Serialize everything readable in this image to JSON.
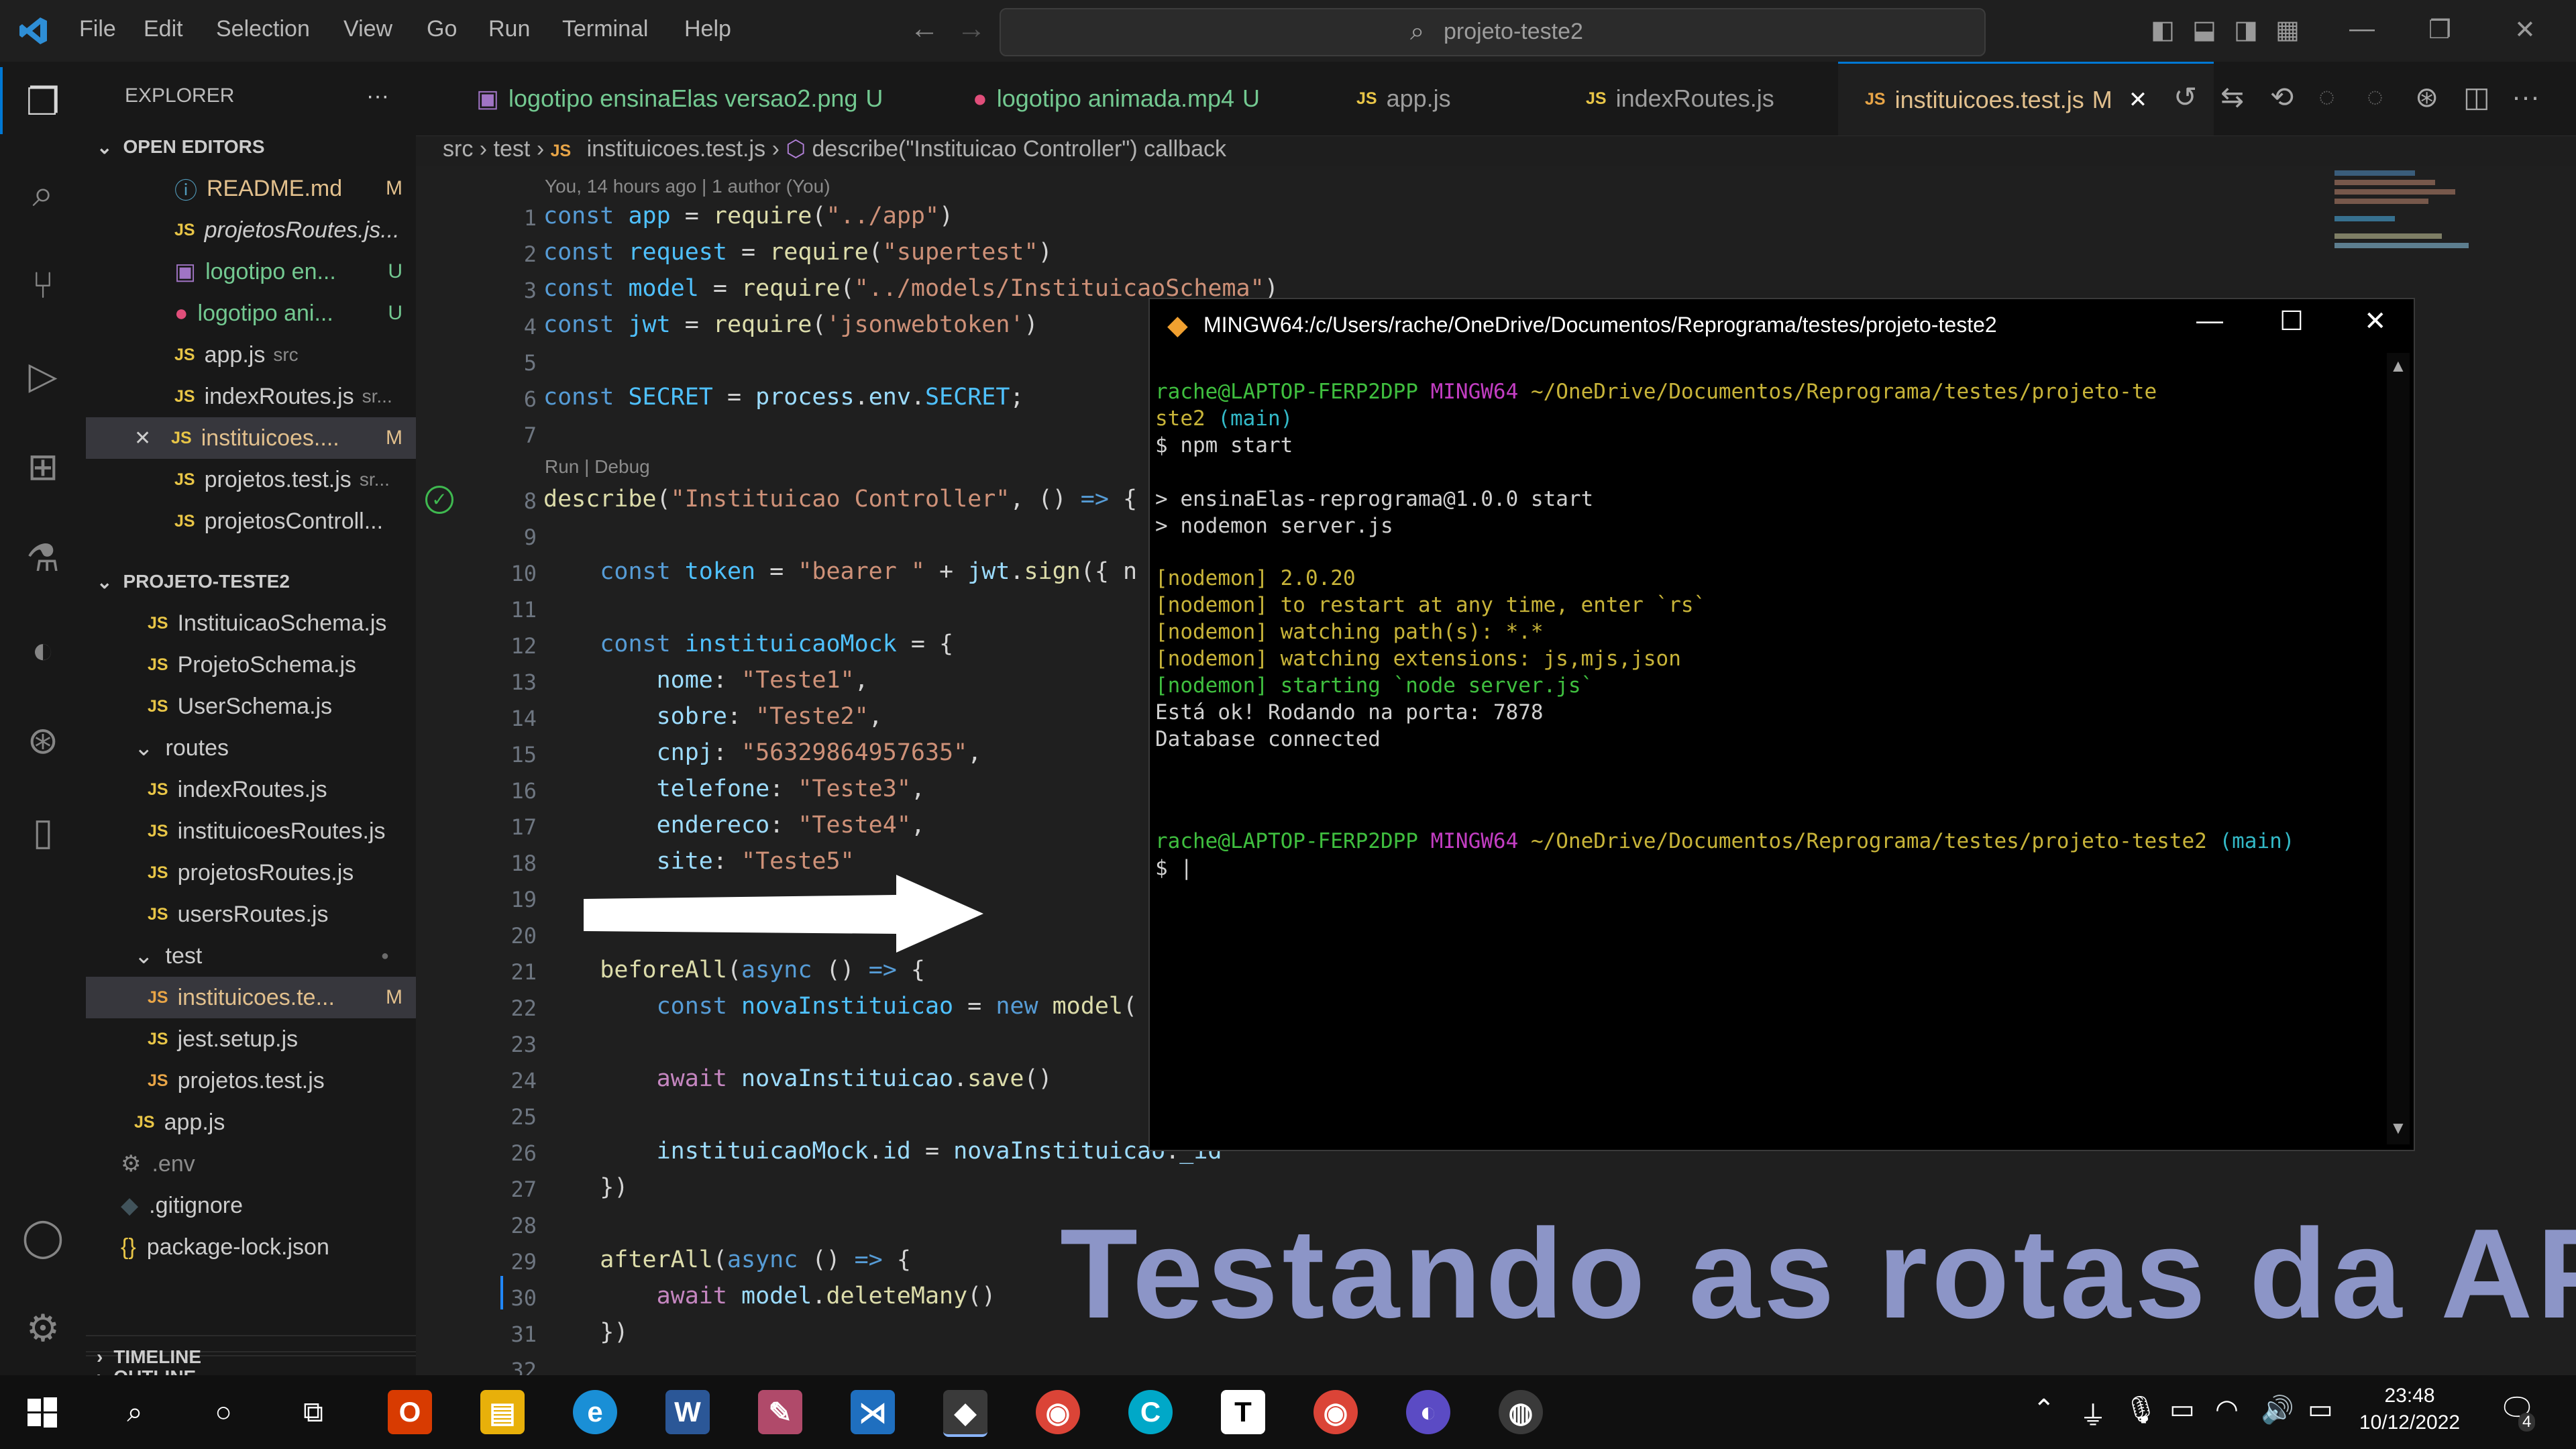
{
  "titlebar": {
    "menu": [
      "File",
      "Edit",
      "Selection",
      "View",
      "Go",
      "Run",
      "Terminal",
      "Help"
    ],
    "search_text": "projeto-teste2"
  },
  "explorer": {
    "title": "EXPLORER",
    "more": "···",
    "open_editors_label": "OPEN EDITORS",
    "open_editors": [
      {
        "name": "README.md",
        "status": "M"
      },
      {
        "name": "projetosRoutes.js...",
        "status": ""
      },
      {
        "name": "logotipo en...",
        "status": "U"
      },
      {
        "name": "logotipo ani...",
        "status": "U"
      },
      {
        "name": "app.js",
        "hint": "src",
        "status": ""
      },
      {
        "name": "indexRoutes.js",
        "hint": "sr...",
        "status": ""
      },
      {
        "name": "instituicoes....",
        "status": "M"
      },
      {
        "name": "projetos.test.js",
        "hint": "sr...",
        "status": ""
      },
      {
        "name": "projetosControll...",
        "status": ""
      }
    ],
    "project_label": "PROJETO-TESTE2",
    "project_files": [
      {
        "name": "InstituicaoSchema.js",
        "indent": 1
      },
      {
        "name": "ProjetoSchema.js",
        "indent": 1
      },
      {
        "name": "UserSchema.js",
        "indent": 1
      },
      {
        "name": "routes",
        "indent": 1,
        "folder": true
      },
      {
        "name": "indexRoutes.js",
        "indent": 1
      },
      {
        "name": "instituicoesRoutes.js",
        "indent": 1
      },
      {
        "name": "projetosRoutes.js",
        "indent": 1
      },
      {
        "name": "usersRoutes.js",
        "indent": 1
      },
      {
        "name": "test",
        "indent": 1,
        "folder": true
      },
      {
        "name": "instituicoes.te...",
        "indent": 1,
        "status": "M"
      },
      {
        "name": "jest.setup.js",
        "indent": 1
      },
      {
        "name": "projetos.test.js",
        "indent": 1
      },
      {
        "name": "app.js",
        "indent": 0
      },
      {
        "name": ".env",
        "indent": 0
      },
      {
        "name": ".gitignore",
        "indent": 0
      },
      {
        "name": "package-lock.json",
        "indent": 0
      }
    ],
    "outline_label": "OUTLINE",
    "timeline_label": "TIMELINE"
  },
  "tabs": [
    {
      "label": "logotipo ensinaElas versao2.png",
      "status": "U"
    },
    {
      "label": "logotipo animada.mp4",
      "status": "U"
    },
    {
      "label": "app.js",
      "status": ""
    },
    {
      "label": "indexRoutes.js",
      "status": ""
    },
    {
      "label": "instituicoes.test.js",
      "status": "M"
    }
  ],
  "breadcrumb": {
    "src": "src",
    "test": "test",
    "file": "instituicoes.test.js",
    "symbol": "describe(\"Instituicao Controller\") callback"
  },
  "editor": {
    "blame": "You, 14 hours ago | 1 author (You)",
    "codelens": "Run | Debug",
    "line_numbers": [
      "1",
      "2",
      "3",
      "4",
      "5",
      "6",
      "7",
      "8",
      "9",
      "10",
      "11",
      "12",
      "13",
      "14",
      "15",
      "16",
      "17",
      "18",
      "19",
      "20",
      "21",
      "22",
      "23",
      "24",
      "25",
      "26",
      "27",
      "28",
      "29",
      "30",
      "31",
      "32"
    ]
  },
  "terminal": {
    "title": "MINGW64:/c/Users/rache/OneDrive/Documentos/Reprograma/testes/projeto-teste2",
    "user": "rache@LAPTOP-FERP2DPP",
    "shell": "MINGW64",
    "path_short": "~/OneDrive/Documentos/Reprograma/testes/projeto-te",
    "path_cont": "ste2",
    "branch": "(main)",
    "cmd": "$ npm start",
    "out1": "> ensinaElas-reprograma@1.0.0 start",
    "out2": "> nodemon server.js",
    "nodemon1": "[nodemon] 2.0.20",
    "nodemon2": "[nodemon] to restart at any time, enter `rs`",
    "nodemon3": "[nodemon] watching path(s): *.*",
    "nodemon4": "[nodemon] watching extensions: js,mjs,json",
    "nodemon5": "[nodemon] starting `node server.js`",
    "out3": "Está ok! Rodando na porta: 7878",
    "out4": "Database connected",
    "path_full": "~/OneDrive/Documentos/Reprograma/testes/projeto-teste2",
    "prompt": "$ |"
  },
  "caption": "Testando as rotas da API",
  "taskbar": {
    "time": "23:48",
    "date": "10/12/2022",
    "notifications": "4"
  },
  "colors": {
    "accent": "#0078d4",
    "caption": "#8c95c7",
    "terminal_green": "#3fbf3f",
    "terminal_magenta": "#c33ec3"
  }
}
